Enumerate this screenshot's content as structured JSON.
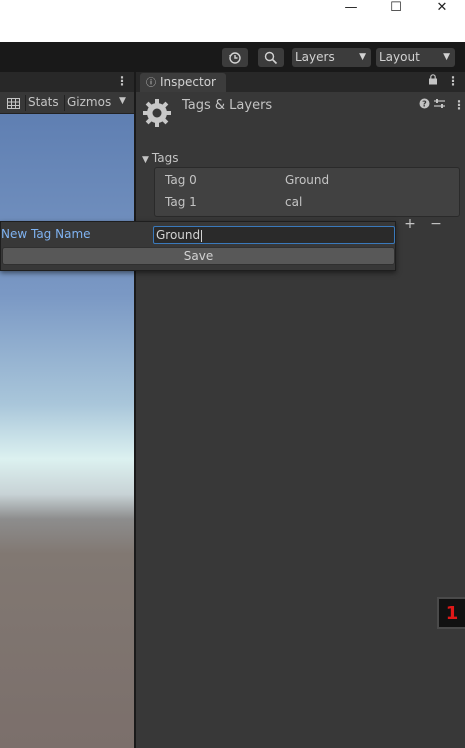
{
  "window": {
    "minimize_glyph": "—",
    "maximize_glyph": "☐",
    "close_glyph": "✕"
  },
  "toolbar": {
    "history_icon": "history-icon",
    "search_icon": "search-icon",
    "layers_label": "Layers",
    "layout_label": "Layout"
  },
  "scene": {
    "stats_label": "Stats",
    "gizmos_label": "Gizmos"
  },
  "inspector": {
    "tab_label": "Inspector",
    "title": "Tags & Layers",
    "tags_section_label": "Tags",
    "tags": [
      {
        "label": "Tag 0",
        "value": "Ground"
      },
      {
        "label": "Tag 1",
        "value": "cal"
      }
    ],
    "add_label": "+",
    "remove_label": "−",
    "badge_text": "1"
  },
  "popup": {
    "label": "New Tag Name",
    "input_value": "Ground",
    "save_label": "Save"
  },
  "colors": {
    "accent_blue": "#3a79bb",
    "label_blue": "#7fb2f0",
    "badge_red": "#e01818"
  }
}
